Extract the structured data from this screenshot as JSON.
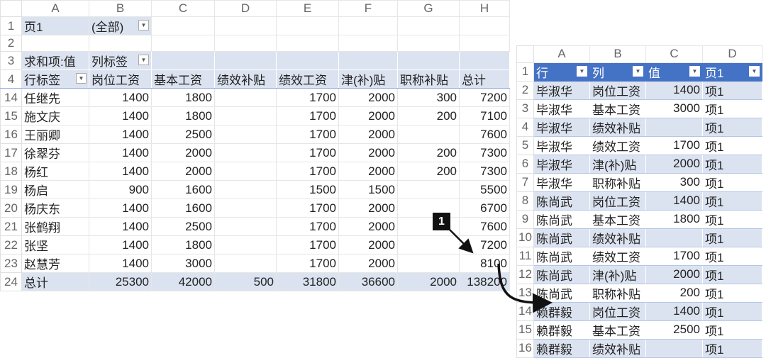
{
  "pivot": {
    "col_headers": [
      "A",
      "B",
      "C",
      "D",
      "E",
      "F",
      "G",
      "H"
    ],
    "row1": {
      "num": "1",
      "label": "页1",
      "value": "(全部)"
    },
    "row2": {
      "num": "2"
    },
    "row3": {
      "num": "3",
      "label": "求和项:值",
      "col_label": "列标签"
    },
    "row4": {
      "num": "4",
      "row_label": "行标签",
      "columns": [
        "岗位工资",
        "基本工资",
        "绩效补贴",
        "绩效工资",
        "津(补)贴",
        "职称补贴",
        "总计"
      ]
    },
    "rows": [
      {
        "num": "14",
        "name": "任继先",
        "v": [
          "1400",
          "1800",
          "",
          "1700",
          "2000",
          "300",
          "7200"
        ]
      },
      {
        "num": "15",
        "name": "施文庆",
        "v": [
          "1400",
          "1800",
          "",
          "1700",
          "2000",
          "200",
          "7100"
        ]
      },
      {
        "num": "16",
        "name": "王丽卿",
        "v": [
          "1400",
          "2500",
          "",
          "1700",
          "2000",
          "",
          "7600"
        ]
      },
      {
        "num": "17",
        "name": "徐翠芬",
        "v": [
          "1400",
          "2000",
          "",
          "1700",
          "2000",
          "200",
          "7300"
        ]
      },
      {
        "num": "18",
        "name": "杨红",
        "v": [
          "1400",
          "2000",
          "",
          "1700",
          "2000",
          "200",
          "7300"
        ]
      },
      {
        "num": "19",
        "name": "杨启",
        "v": [
          "900",
          "1600",
          "",
          "1500",
          "1500",
          "",
          "5500"
        ]
      },
      {
        "num": "20",
        "name": "杨庆东",
        "v": [
          "1400",
          "1600",
          "",
          "1700",
          "2000",
          "",
          "6700"
        ]
      },
      {
        "num": "21",
        "name": "张鹤翔",
        "v": [
          "1400",
          "2500",
          "",
          "1700",
          "2000",
          "",
          "7600"
        ]
      },
      {
        "num": "22",
        "name": "张坚",
        "v": [
          "1400",
          "1800",
          "",
          "1700",
          "2000",
          "",
          "7200"
        ]
      },
      {
        "num": "23",
        "name": "赵慧芳",
        "v": [
          "1400",
          "3000",
          "",
          "1700",
          "2000",
          "",
          "8100"
        ]
      }
    ],
    "total": {
      "num": "24",
      "name": "总计",
      "v": [
        "25300",
        "42000",
        "500",
        "31800",
        "36600",
        "2000",
        "138200"
      ]
    }
  },
  "source": {
    "col_headers": [
      "A",
      "B",
      "C",
      "D"
    ],
    "header": {
      "num": "1",
      "cols": [
        "行",
        "列",
        "值",
        "页1"
      ]
    },
    "rows": [
      {
        "num": "2",
        "a": "毕淑华",
        "b": "岗位工资",
        "c": "1400",
        "d": "项1"
      },
      {
        "num": "3",
        "a": "毕淑华",
        "b": "基本工资",
        "c": "3000",
        "d": "项1"
      },
      {
        "num": "4",
        "a": "毕淑华",
        "b": "绩效补贴",
        "c": "",
        "d": "项1"
      },
      {
        "num": "5",
        "a": "毕淑华",
        "b": "绩效工资",
        "c": "1700",
        "d": "项1"
      },
      {
        "num": "6",
        "a": "毕淑华",
        "b": "津(补)贴",
        "c": "2000",
        "d": "项1"
      },
      {
        "num": "7",
        "a": "毕淑华",
        "b": "职称补贴",
        "c": "300",
        "d": "项1"
      },
      {
        "num": "8",
        "a": "陈尚武",
        "b": "岗位工资",
        "c": "1400",
        "d": "项1"
      },
      {
        "num": "9",
        "a": "陈尚武",
        "b": "基本工资",
        "c": "1800",
        "d": "项1"
      },
      {
        "num": "10",
        "a": "陈尚武",
        "b": "绩效补贴",
        "c": "",
        "d": "项1"
      },
      {
        "num": "11",
        "a": "陈尚武",
        "b": "绩效工资",
        "c": "1700",
        "d": "项1"
      },
      {
        "num": "12",
        "a": "陈尚武",
        "b": "津(补)贴",
        "c": "2000",
        "d": "项1"
      },
      {
        "num": "13",
        "a": "陈尚武",
        "b": "职称补贴",
        "c": "200",
        "d": "项1"
      },
      {
        "num": "14",
        "a": "赖群毅",
        "b": "岗位工资",
        "c": "1400",
        "d": "项1"
      },
      {
        "num": "15",
        "a": "赖群毅",
        "b": "基本工资",
        "c": "2500",
        "d": "项1"
      },
      {
        "num": "16",
        "a": "赖群毅",
        "b": "绩效补贴",
        "c": "",
        "d": "项1"
      }
    ]
  },
  "annotation": {
    "label": "1"
  }
}
